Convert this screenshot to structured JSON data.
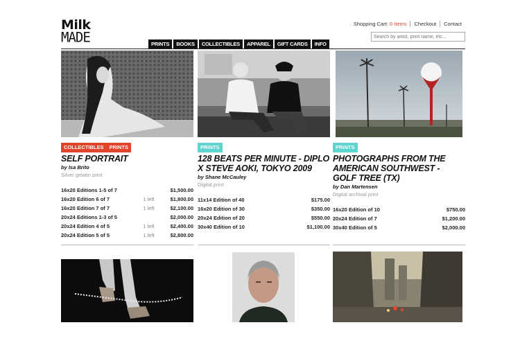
{
  "logo": {
    "line1": "Milk",
    "line2": "MADE"
  },
  "header": {
    "cart_label": "Shopping Cart:",
    "cart_count": "0 Items",
    "checkout": "Checkout",
    "contact": "Contact",
    "search_placeholder": "Search by artist, print name, etc..."
  },
  "nav": [
    "PRINTS",
    "BOOKS",
    "COLLECTIBLES",
    "APPAREL",
    "GIFT CARDS",
    "INFO"
  ],
  "products": [
    {
      "tags": [
        "COLLECTIBLES",
        "PRINTS"
      ],
      "title": "SELF PORTRAIT",
      "by": "by Isa Brito",
      "type": "Silver gelatin print",
      "editions": [
        {
          "name": "16x20 Editions 1-5 of 7",
          "left": "",
          "price": "$1,500.00"
        },
        {
          "name": "16x20 Edition 6 of 7",
          "left": "1 left",
          "price": "$1,800.00"
        },
        {
          "name": "16x20 Edition 7 of 7",
          "left": "1 left",
          "price": "$2,100.00"
        },
        {
          "name": "20x24 Editions 1-3 of 5",
          "left": "",
          "price": "$2,000.00"
        },
        {
          "name": "20x24 Edition 4 of 5",
          "left": "1 left",
          "price": "$2,400.00"
        },
        {
          "name": "20x24 Edition 5 of 5",
          "left": "1 left",
          "price": "$2,800.00"
        }
      ]
    },
    {
      "tags": [
        "PRINTS"
      ],
      "title": "128 BEATS PER MINUTE - DIPLO X STEVE AOKI, TOKYO 2009",
      "by": "by Shane McCauley",
      "type": "Digital print",
      "editions": [
        {
          "name": "11x14 Edition of 40",
          "left": "",
          "price": "$175.00"
        },
        {
          "name": "16x20 Edition of 30",
          "left": "",
          "price": "$350.00"
        },
        {
          "name": "20x24 Edition of 20",
          "left": "",
          "price": "$550.00"
        },
        {
          "name": "30x40 Edition of 10",
          "left": "",
          "price": "$1,100.00"
        }
      ]
    },
    {
      "tags": [
        "PRINTS"
      ],
      "title": "PHOTOGRAPHS FROM THE AMERICAN SOUTHWEST - GOLF TREE (TX)",
      "by": "by Dan Martensen",
      "type": "Digital archival print",
      "editions": [
        {
          "name": "16x20 Edition of 10",
          "left": "",
          "price": "$750.00"
        },
        {
          "name": "20x24 Edition of 7",
          "left": "",
          "price": "$1,200.00"
        },
        {
          "name": "30x40 Edition of 5",
          "left": "",
          "price": "$2,000.00"
        }
      ]
    }
  ]
}
